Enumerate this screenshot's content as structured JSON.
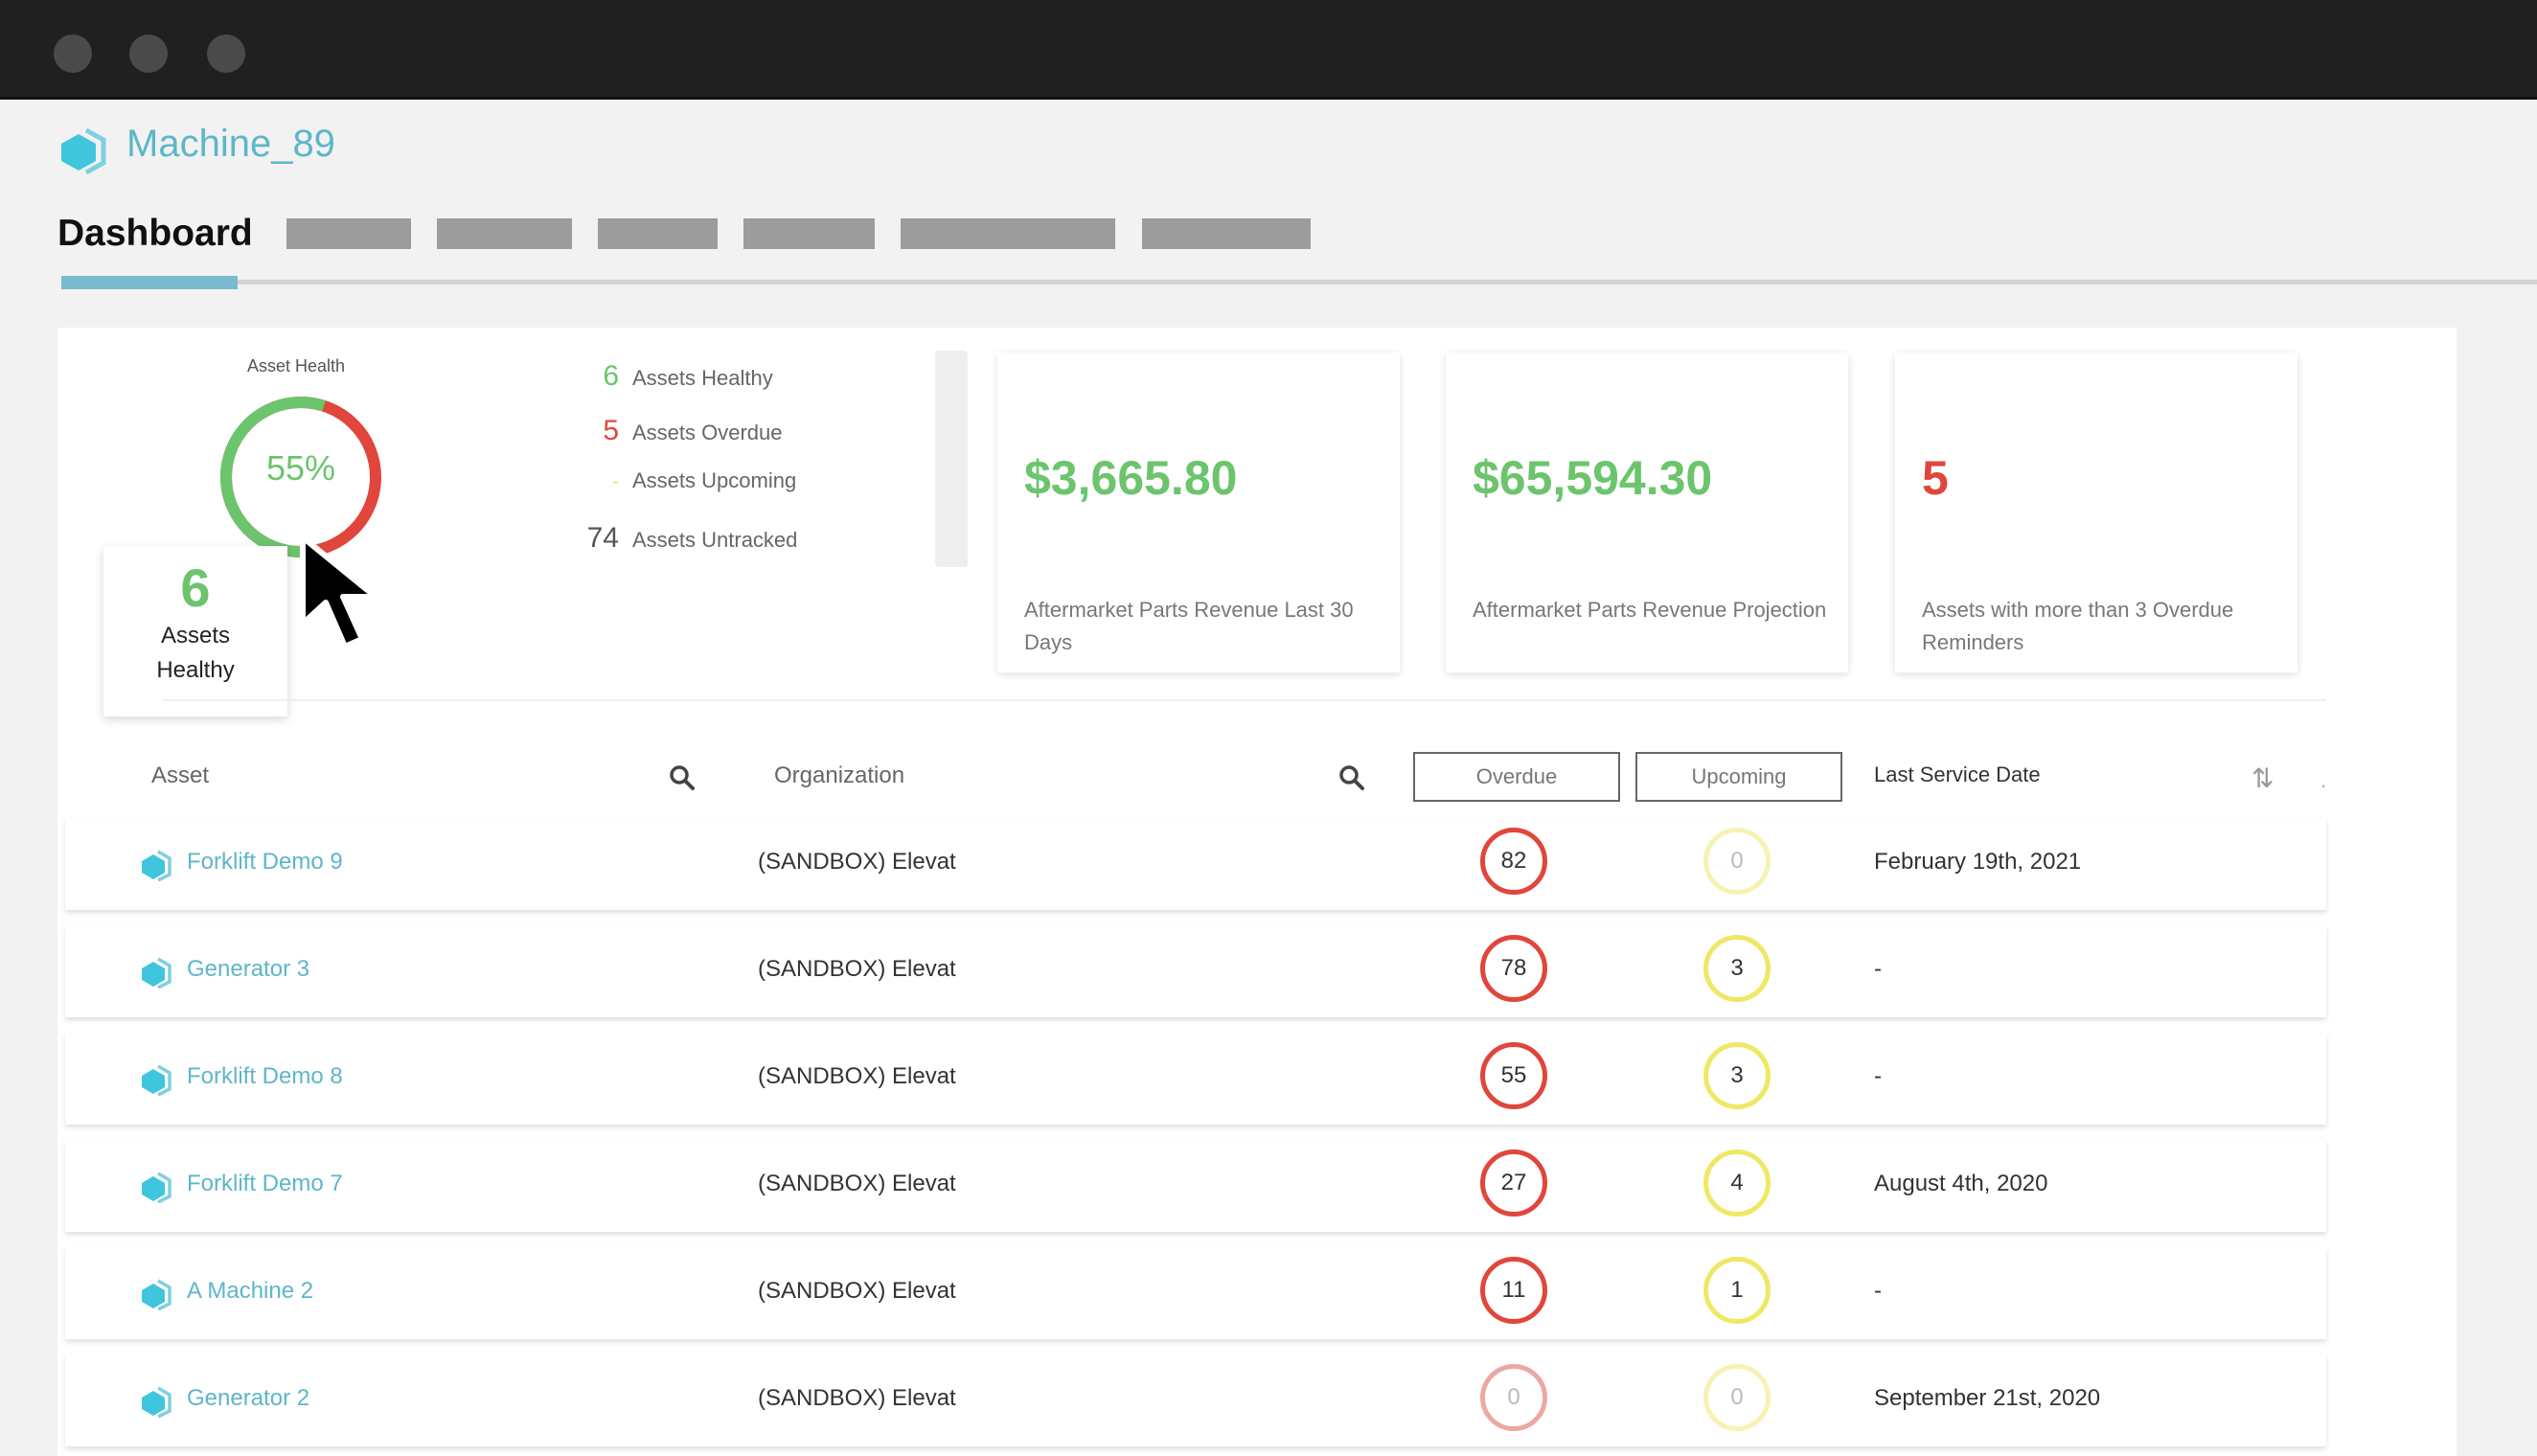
{
  "app": {
    "title": "Machine_89"
  },
  "tabs": {
    "active_label": "Dashboard"
  },
  "gauge": {
    "title": "Asset Health",
    "percent_label": "55%",
    "healthy_fraction": 0.55,
    "healthy_color": "#6cc46d",
    "overdue_color": "#e0463c"
  },
  "tooltip": {
    "value": "6",
    "label_line1": "Assets",
    "label_line2": "Healthy"
  },
  "stats": [
    {
      "value": "6",
      "label": "Assets Healthy",
      "color": "#6cc46d"
    },
    {
      "value": "5",
      "label": "Assets Overdue",
      "color": "#e0463c"
    },
    {
      "value": "-",
      "label": "Assets Upcoming",
      "color": "#e7e36a"
    },
    {
      "value": "74",
      "label": "Assets Untracked",
      "color": "#555555"
    }
  ],
  "cards": [
    {
      "value": "$3,665.80",
      "label": "Aftermarket Parts Revenue Last 30 Days",
      "color": "#6cc46d"
    },
    {
      "value": "$65,594.30",
      "label": "Aftermarket Parts Revenue Projection",
      "color": "#6cc46d"
    },
    {
      "value": "5",
      "label": "Assets with more than 3 Overdue Reminders",
      "color": "#e0463c"
    }
  ],
  "table": {
    "headers": {
      "asset": "Asset",
      "organization": "Organization",
      "overdue": "Overdue",
      "upcoming": "Upcoming",
      "last_service": "Last Service Date"
    },
    "rows": [
      {
        "asset": "Forklift Demo 9",
        "org": "(SANDBOX) Elevat",
        "overdue": "82",
        "upcoming": "0",
        "last_service": "February 19th, 2021"
      },
      {
        "asset": "Generator 3",
        "org": "(SANDBOX) Elevat",
        "overdue": "78",
        "upcoming": "3",
        "last_service": "-"
      },
      {
        "asset": "Forklift Demo 8",
        "org": "(SANDBOX) Elevat",
        "overdue": "55",
        "upcoming": "3",
        "last_service": "-"
      },
      {
        "asset": "Forklift Demo 7",
        "org": "(SANDBOX) Elevat",
        "overdue": "27",
        "upcoming": "4",
        "last_service": "August 4th, 2020"
      },
      {
        "asset": "A Machine 2",
        "org": "(SANDBOX) Elevat",
        "overdue": "11",
        "upcoming": "1",
        "last_service": "-"
      },
      {
        "asset": "Generator 2",
        "org": "(SANDBOX) Elevat",
        "overdue": "0",
        "upcoming": "0",
        "last_service": "September 21st, 2020"
      }
    ]
  },
  "colors": {
    "accent": "#5eb6c9",
    "overdue_ring": "#e0463c",
    "overdue_ring_zero": "#eda8a4",
    "upcoming_ring": "#efe863",
    "upcoming_ring_zero": "#f6f2b4"
  }
}
